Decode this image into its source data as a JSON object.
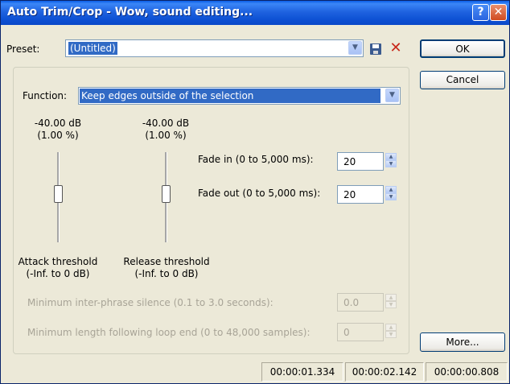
{
  "window": {
    "title": "Auto Trim/Crop - Wow, sound editing..."
  },
  "titlebar": {
    "help_icon": "?",
    "close_icon": "✕"
  },
  "preset": {
    "label": "Preset:",
    "value": "(Untitled)"
  },
  "icons": {
    "save": "save-icon",
    "delete": "delete-icon",
    "delete_glyph": "✕"
  },
  "buttons": {
    "ok": "OK",
    "cancel": "Cancel",
    "more": "More..."
  },
  "function": {
    "label": "Function:",
    "value": "Keep edges outside of the selection"
  },
  "attack": {
    "db": "-40.00 dB",
    "pct": "(1.00 %)",
    "label1": "Attack threshold",
    "label2": "(-Inf. to 0 dB)",
    "level": 0.45
  },
  "release": {
    "db": "-40.00 dB",
    "pct": "(1.00 %)",
    "label1": "Release threshold",
    "label2": "(-Inf. to 0 dB)",
    "level": 0.45
  },
  "fade_in": {
    "label": "Fade in (0 to 5,000 ms):",
    "value": "20"
  },
  "fade_out": {
    "label": "Fade out (0 to 5,000 ms):",
    "value": "20"
  },
  "min_silence": {
    "label": "Minimum inter-phrase silence (0.1 to 3.0 seconds):",
    "value": "0.0"
  },
  "min_length": {
    "label": "Minimum length following loop end (0 to 48,000 samples):",
    "value": "0"
  },
  "status": {
    "t1": "00:00:01.334",
    "t2": "00:00:02.142",
    "t3": "00:00:00.808"
  },
  "colors": {
    "titlebar": "#0c4fd2",
    "selection": "#316ac5",
    "close": "#d04a1f",
    "delete": "#c8281a"
  }
}
